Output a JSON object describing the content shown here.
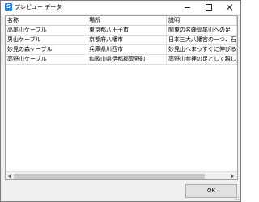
{
  "window": {
    "title": "プレビュー データ",
    "icon": "app-icon",
    "icon_glyph": "S"
  },
  "table": {
    "columns": [
      "名称",
      "場所",
      "説明"
    ],
    "rows": [
      [
        "高尾山ケーブル",
        "東京都八王子市",
        "関東の名峰高尾山への足"
      ],
      [
        "男山ケーブル",
        "京都府八幡市",
        "日本三大八幡宮の一つ、石清水"
      ],
      [
        "妙見の森ケーブル",
        "兵庫県川西市",
        "妙見山へまっすぐに伸びる軌道の"
      ],
      [
        "高野山ケーブル",
        "和歌山県伊都郡高野町",
        "高野山参拝の足として親しまれて"
      ]
    ]
  },
  "buttons": {
    "ok": "OK"
  }
}
